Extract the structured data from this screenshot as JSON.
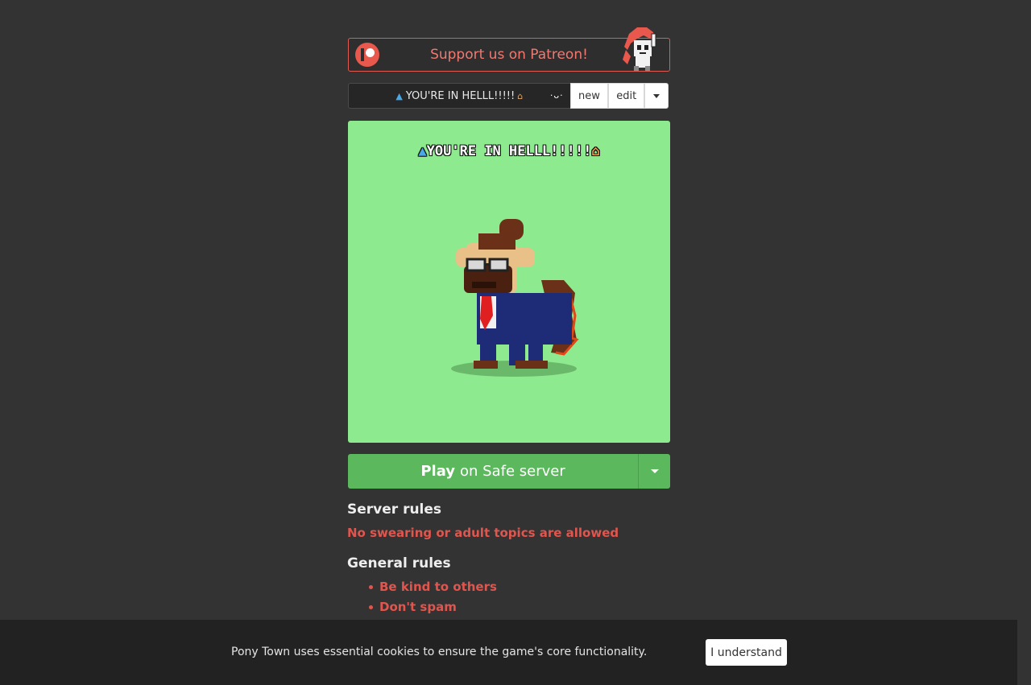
{
  "patreon": {
    "label": "Support us on Patreon!"
  },
  "character": {
    "name": "YOU'RE IN HELLL!!!!!",
    "new_label": "new",
    "edit_label": "edit"
  },
  "preview": {
    "name": "YOU'RE IN HELLL!!!!!"
  },
  "play": {
    "bold": "Play",
    "rest": "on Safe server"
  },
  "server_rules": {
    "heading": "Server rules",
    "text": "No swearing or adult topics are allowed"
  },
  "general_rules": {
    "heading": "General rules",
    "items": [
      "Be kind to others",
      "Don't spam"
    ]
  },
  "cookie": {
    "text": "Pony Town uses essential cookies to ensure the game's core functionality.",
    "button": "I understand"
  },
  "colors": {
    "background": "#333333",
    "preview_bg": "#8eea8e",
    "play_green": "#5cb85c",
    "rule_red": "#e0564e",
    "patreon": "#e8584c"
  }
}
